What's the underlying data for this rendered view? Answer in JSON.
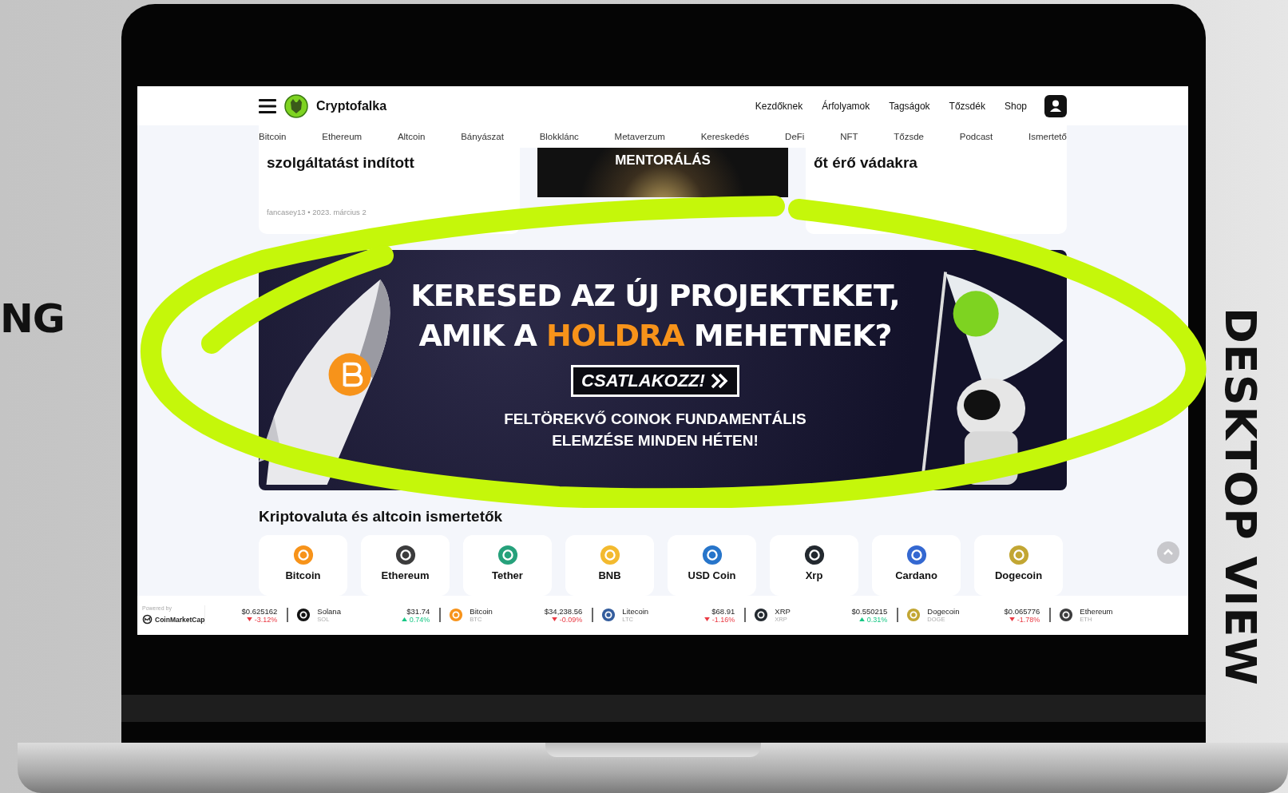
{
  "side_text_left": "NG",
  "side_text_right": "DESKTOP VIEW",
  "site": {
    "logo_text": "Cryptofalka",
    "top_nav": [
      "Kezdőknek",
      "Árfolyamok",
      "Tagságok",
      "Tőzsdék",
      "Shop"
    ],
    "categories": [
      "Bitcoin",
      "Ethereum",
      "Altcoin",
      "Bányászat",
      "Blokklánc",
      "Metaverzum",
      "Kereskedés",
      "DeFi",
      "NFT",
      "Tőzsde",
      "Podcast",
      "Ismertető"
    ],
    "articles": [
      {
        "kind": "text",
        "title": "szolgáltatást indított",
        "meta": "fancasey13 • 2023. március 2"
      },
      {
        "kind": "image",
        "title": "MENTORÁLÁS"
      },
      {
        "kind": "text",
        "title": "őt érő vádakra"
      }
    ],
    "banner": {
      "headline_1": "KERESED AZ ÚJ PROJEKTEKET,",
      "headline_2": [
        {
          "text": "AMIK A ",
          "highlight": false
        },
        {
          "text": "HOLDRA",
          "highlight": true
        },
        {
          "text": " MEHETNEK?",
          "highlight": false
        }
      ],
      "button": "CSATLAKOZZ!",
      "subtext_1": "FELTÖREKVŐ COINOK FUNDAMENTÁLIS",
      "subtext_2": "ELEMZÉSE MINDEN HÉTEN!"
    },
    "section_title": "Kriptovaluta és altcoin ismertetők",
    "coins": [
      {
        "name": "Bitcoin",
        "kind": "btc"
      },
      {
        "name": "Ethereum",
        "kind": "eth"
      },
      {
        "name": "Tether",
        "kind": "usdt"
      },
      {
        "name": "BNB",
        "kind": "bnb"
      },
      {
        "name": "USD Coin",
        "kind": "usdc"
      },
      {
        "name": "Xrp",
        "kind": "xrp"
      },
      {
        "name": "Cardano",
        "kind": "ada"
      },
      {
        "name": "Dogecoin",
        "kind": "doge"
      }
    ],
    "ticker": {
      "powered_by": "Powered by",
      "brand": "CoinMarketCap",
      "items": [
        {
          "price": "$0.625162",
          "change": "-3.12%",
          "up": false
        },
        {
          "kind": "sol",
          "name": "Solana",
          "symbol": "SOL",
          "price": "$31.74",
          "change": "0.74%",
          "up": true
        },
        {
          "kind": "btc",
          "name": "Bitcoin",
          "symbol": "BTC",
          "price": "$34,238.56",
          "change": "-0.09%",
          "up": false
        },
        {
          "kind": "ltc",
          "name": "Litecoin",
          "symbol": "LTC",
          "price": "$68.91",
          "change": "-1.16%",
          "up": false
        },
        {
          "kind": "xrp",
          "name": "XRP",
          "symbol": "XRP",
          "price": "$0.550215",
          "change": "0.31%",
          "up": true
        },
        {
          "kind": "doge",
          "name": "Dogecoin",
          "symbol": "DOGE",
          "price": "$0.065776",
          "change": "-1.78%",
          "up": false
        },
        {
          "kind": "eth",
          "name": "Ethereum",
          "symbol": "ETH"
        }
      ]
    }
  }
}
